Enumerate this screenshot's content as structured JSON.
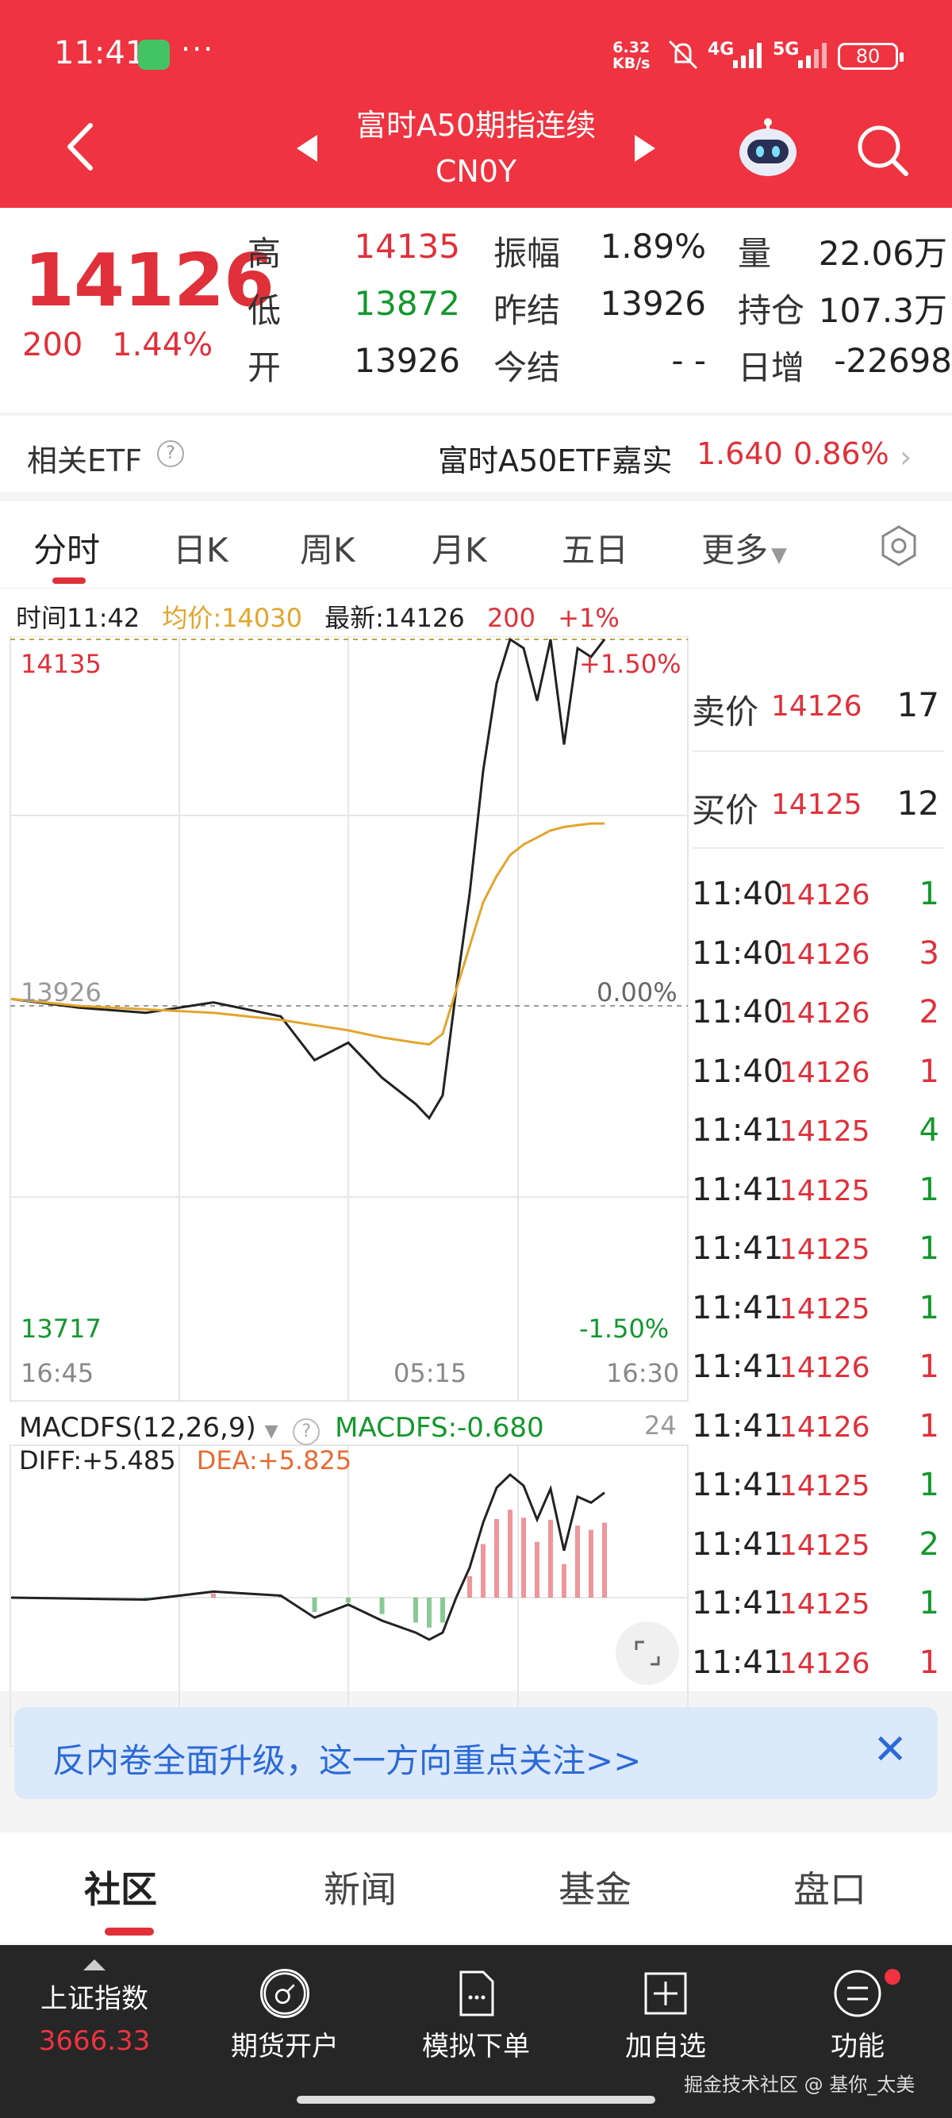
{
  "status_bar": {
    "time": "11:41",
    "dots": "···",
    "speed": "6.32\nKB/s",
    "net1": "4G",
    "net2": "5G",
    "battery": "80"
  },
  "header": {
    "title": "富时A50期指连续",
    "subtitle": "CN0Y"
  },
  "quote": {
    "price": "14126",
    "change": "200",
    "change_pct": "1.44%",
    "fields": [
      {
        "label": "高",
        "value": "14135",
        "color": "red"
      },
      {
        "label": "低",
        "value": "13872",
        "color": "green"
      },
      {
        "label": "开",
        "value": "13926",
        "color": "dark"
      },
      {
        "label": "振幅",
        "value": "1.89%",
        "color": "dark"
      },
      {
        "label": "昨结",
        "value": "13926",
        "color": "dark"
      },
      {
        "label": "今结",
        "value": "- -",
        "color": "dark"
      },
      {
        "label": "量",
        "value": "22.06万",
        "color": "dark"
      },
      {
        "label": "持仓",
        "value": "107.3万",
        "color": "dark"
      },
      {
        "label": "日增",
        "value": "-22698",
        "color": "dark"
      }
    ]
  },
  "etf": {
    "label": "相关ETF",
    "help": "?",
    "name": "富时A50ETF嘉实",
    "price": "1.640",
    "pct": "0.86%",
    "chevron": "›"
  },
  "tabs": [
    "分时",
    "日K",
    "周K",
    "月K",
    "五日",
    "更多"
  ],
  "chart_info": {
    "time": "时间11:42",
    "avg": "均价:14030",
    "latest": "最新:14126",
    "chg": "200",
    "pct": "+1%"
  },
  "chart_axes": {
    "y_top": "14135",
    "y_mid": "13926",
    "y_bottom": "13717",
    "pct_top": "+1.50%",
    "pct_mid": "0.00%",
    "pct_bottom": "-1.50%",
    "x_labels": [
      "16:45",
      "05:15",
      "16:30"
    ]
  },
  "macd": {
    "name": "MACDFS(12,26,9)",
    "value_label": "MACDFS:-0.680",
    "right_num": "24",
    "diff": "DIFF:+5.485",
    "dea": "DEA:+5.825"
  },
  "chart_data": {
    "type": "line",
    "series": [
      {
        "x": [
          0,
          10,
          20,
          30,
          40,
          45,
          50,
          55,
          60,
          62,
          64,
          66,
          68,
          70,
          72,
          74,
          76,
          78,
          80,
          82,
          84,
          86,
          88,
          90,
          92,
          94,
          96,
          98,
          100
        ],
        "values": [
          13930,
          13925,
          13922,
          13928,
          13920,
          13895,
          13905,
          13885,
          13870,
          13862,
          13875,
          13935,
          13990,
          14060,
          14110,
          14135,
          14130,
          14100,
          14135,
          14075,
          14130,
          14125,
          14135,
          null,
          null,
          null,
          null,
          null,
          null
        ]
      },
      {
        "x": [
          0,
          10,
          20,
          30,
          40,
          45,
          50,
          55,
          60,
          62,
          64,
          66,
          68,
          70,
          72,
          74,
          76,
          78,
          80,
          82,
          84,
          86,
          88,
          90,
          92,
          94,
          96,
          98,
          100
        ],
        "values": [
          13930,
          13926,
          13924,
          13922,
          13918,
          13915,
          13912,
          13908,
          13905,
          13904,
          13910,
          13935,
          13960,
          13985,
          14000,
          14012,
          14018,
          14022,
          14026,
          14028,
          14029,
          14030,
          14030,
          null,
          null,
          null,
          null,
          null,
          null
        ]
      }
    ],
    "ylim": [
      13717,
      14135
    ]
  },
  "order_book": [
    {
      "label": "卖价",
      "price": "14126",
      "vol": "17"
    },
    {
      "label": "买价",
      "price": "14125",
      "vol": "12"
    }
  ],
  "trades": [
    {
      "time": "11:40",
      "price": "14126",
      "vol": "1",
      "pc": "red",
      "vc": "green"
    },
    {
      "time": "11:40",
      "price": "14126",
      "vol": "3",
      "pc": "red",
      "vc": "red"
    },
    {
      "time": "11:40",
      "price": "14126",
      "vol": "2",
      "pc": "red",
      "vc": "red"
    },
    {
      "time": "11:40",
      "price": "14126",
      "vol": "1",
      "pc": "red",
      "vc": "red"
    },
    {
      "time": "11:41",
      "price": "14125",
      "vol": "4",
      "pc": "red",
      "vc": "green"
    },
    {
      "time": "11:41",
      "price": "14125",
      "vol": "1",
      "pc": "red",
      "vc": "green"
    },
    {
      "time": "11:41",
      "price": "14125",
      "vol": "1",
      "pc": "red",
      "vc": "green"
    },
    {
      "time": "11:41",
      "price": "14125",
      "vol": "1",
      "pc": "red",
      "vc": "green"
    },
    {
      "time": "11:41",
      "price": "14126",
      "vol": "1",
      "pc": "red",
      "vc": "red"
    },
    {
      "time": "11:41",
      "price": "14126",
      "vol": "1",
      "pc": "red",
      "vc": "red"
    },
    {
      "time": "11:41",
      "price": "14125",
      "vol": "1",
      "pc": "red",
      "vc": "green"
    },
    {
      "time": "11:41",
      "price": "14125",
      "vol": "2",
      "pc": "red",
      "vc": "green"
    },
    {
      "time": "11:41",
      "price": "14125",
      "vol": "1",
      "pc": "red",
      "vc": "green"
    },
    {
      "time": "11:41",
      "price": "14126",
      "vol": "1",
      "pc": "red",
      "vc": "red"
    }
  ],
  "banner": {
    "text": "反内卷全面升级，这一方向重点关注>>",
    "close": "✕"
  },
  "bottom_tabs": [
    "社区",
    "新闻",
    "基金",
    "盘口"
  ],
  "bottom_bar": {
    "index_name": "上证指数",
    "index_value": "3666.33",
    "items": [
      "期货开户",
      "模拟下单",
      "加自选",
      "功能"
    ],
    "watermark": "掘金技术社区 @ 基你_太美"
  },
  "colors": {
    "brand": "#ef3340",
    "up": "#e0303a",
    "down": "#13972c",
    "avg_line": "#e2a52c"
  }
}
